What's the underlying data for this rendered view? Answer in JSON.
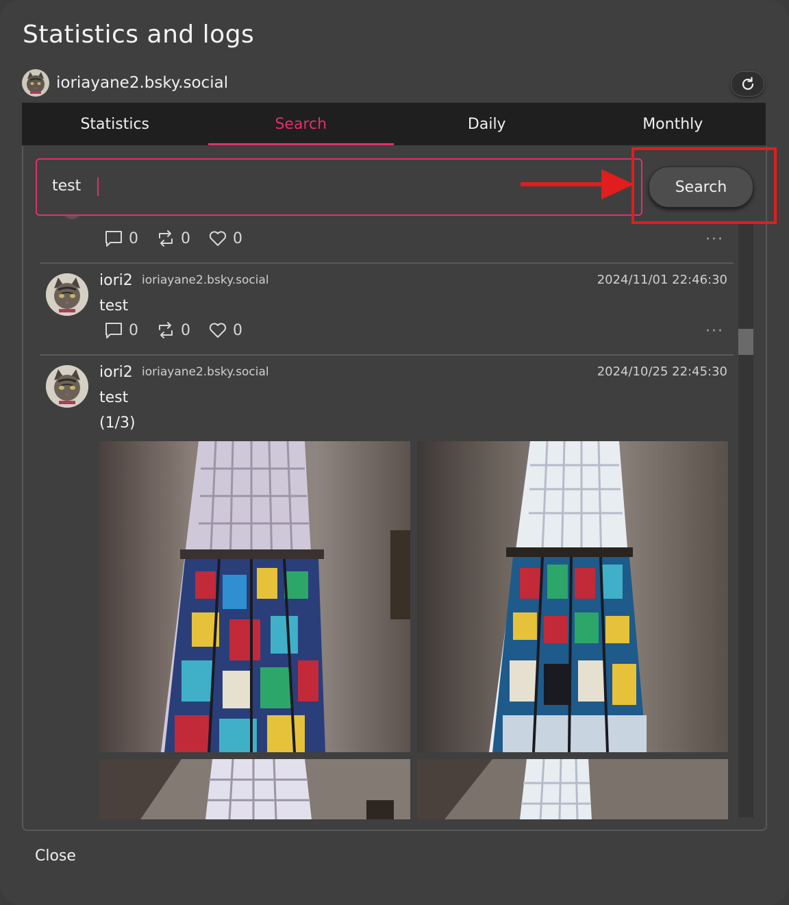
{
  "dialog": {
    "title": "Statistics and logs",
    "account_handle": "ioriayane2.bsky.social",
    "close_label": "Close"
  },
  "tabs": [
    {
      "label": "Statistics",
      "active": false
    },
    {
      "label": "Search",
      "active": true
    },
    {
      "label": "Daily",
      "active": false
    },
    {
      "label": "Monthly",
      "active": false
    }
  ],
  "search": {
    "value": "test",
    "button_label": "Search"
  },
  "posts": [
    {
      "partial": true,
      "replies": "0",
      "reposts": "0",
      "likes": "0"
    },
    {
      "name": "iori2",
      "handle": "ioriayane2.bsky.social",
      "timestamp": "2024/11/01 22:46:30",
      "text": "test",
      "replies": "0",
      "reposts": "0",
      "likes": "0"
    },
    {
      "name": "iori2",
      "handle": "ioriayane2.bsky.social",
      "timestamp": "2024/10/25 22:45:30",
      "text": "test",
      "image_counter": "(1/3)"
    }
  ],
  "colors": {
    "accent": "#e0306e",
    "annotation_red": "#e21d1d",
    "background": "#3f3f3f",
    "tab_bar": "#1f1f1f"
  },
  "icons": [
    "refresh-icon",
    "reply-icon",
    "repost-icon",
    "like-icon",
    "more-icon"
  ]
}
